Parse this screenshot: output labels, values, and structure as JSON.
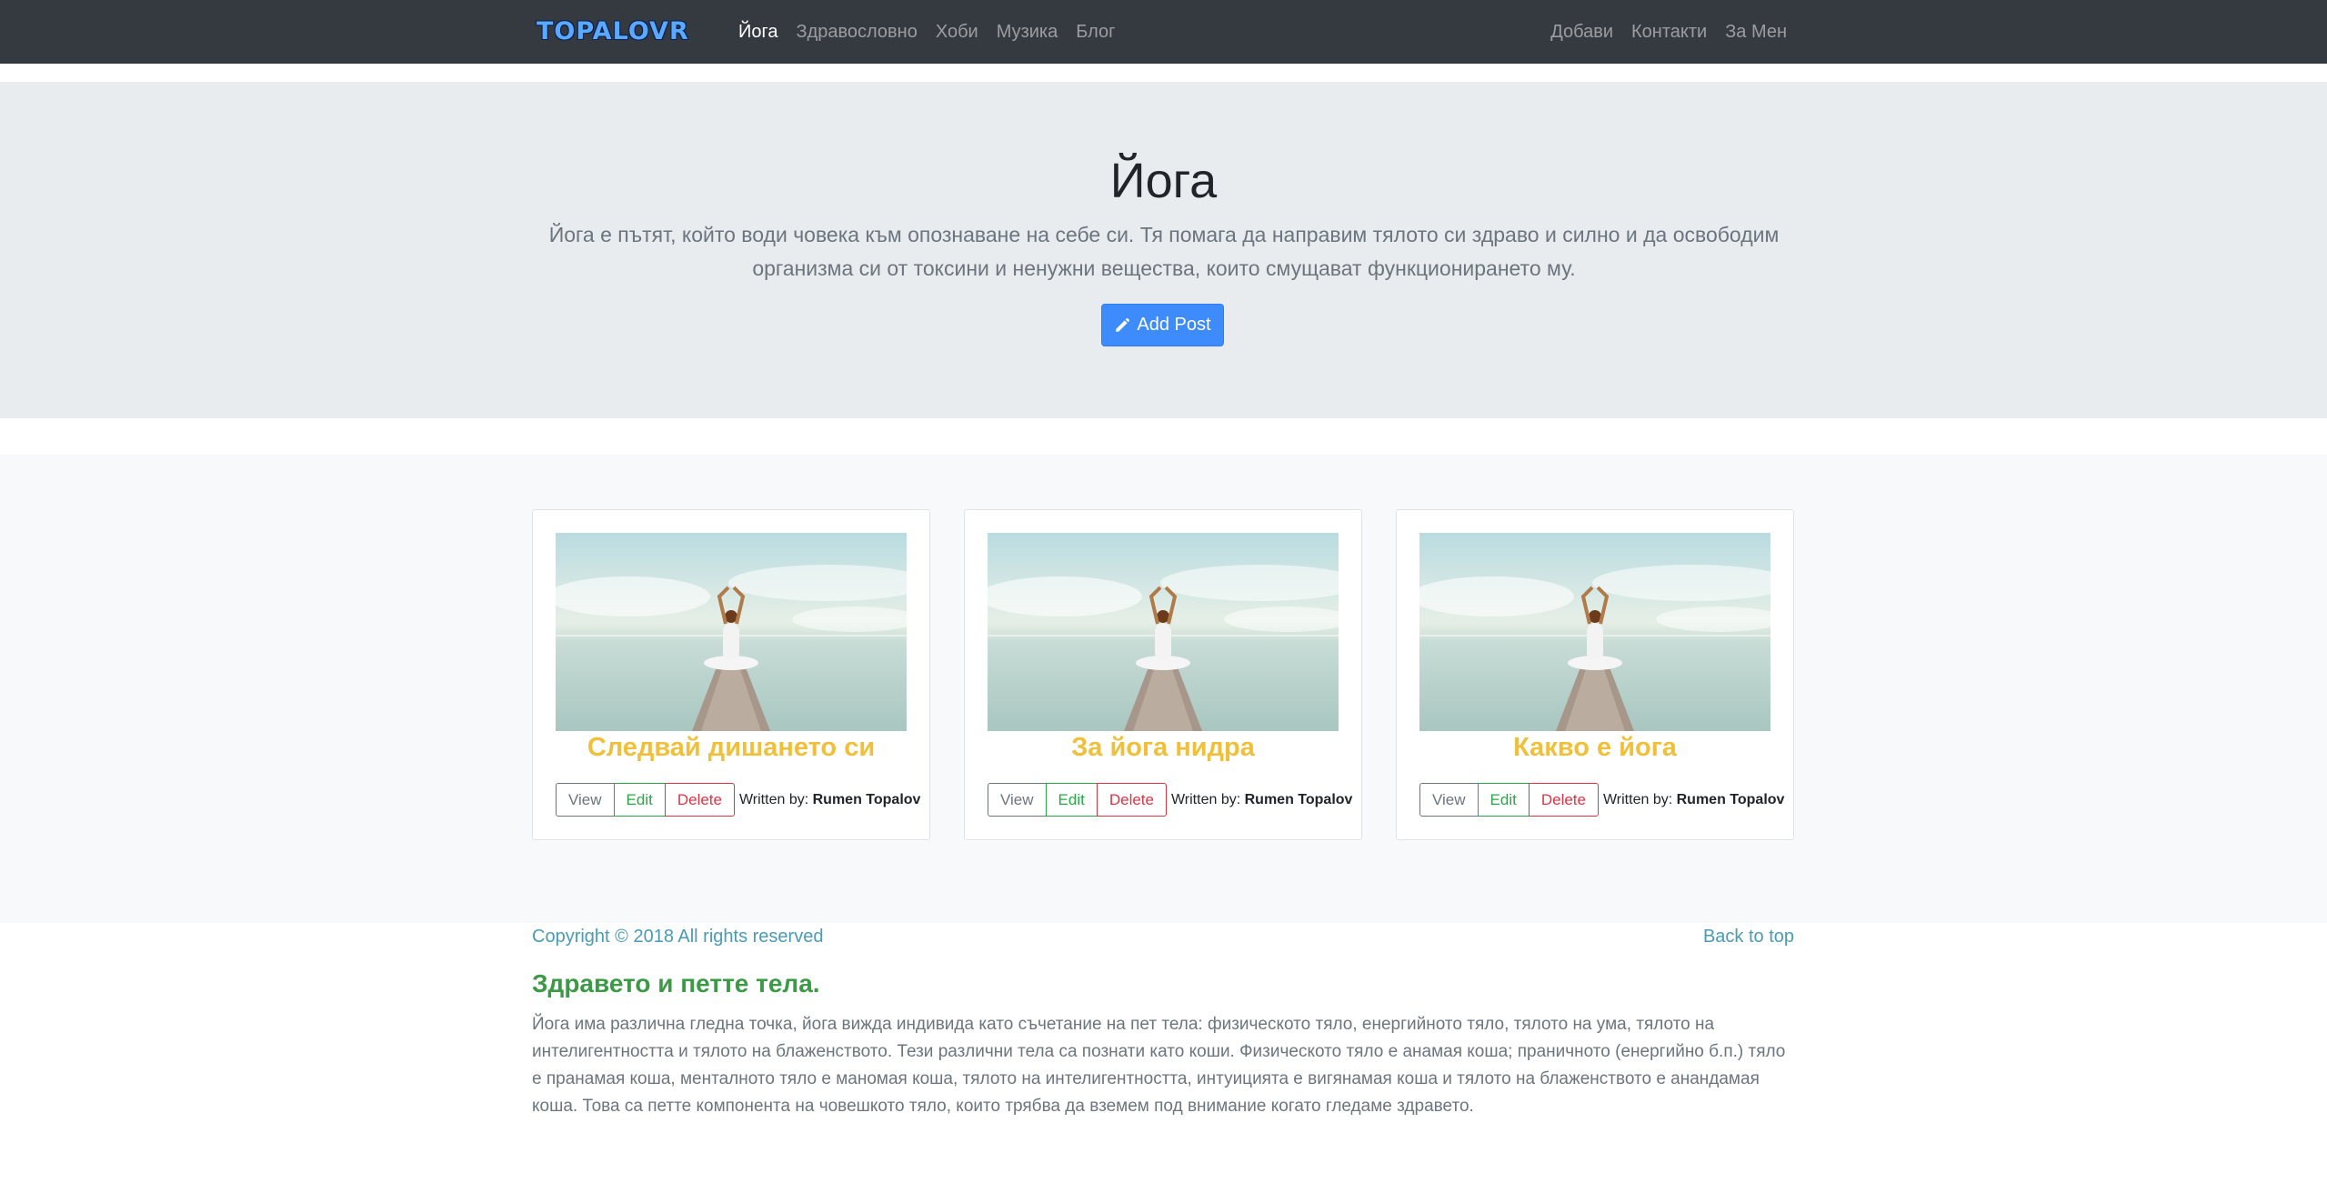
{
  "navbar": {
    "brand": "TOPALOVR",
    "left_links": [
      "Йога",
      "Здравословно",
      "Хоби",
      "Музика",
      "Блог"
    ],
    "right_links": [
      "Добави",
      "Контакти",
      "За Мен"
    ]
  },
  "jumbotron": {
    "title": "Йога",
    "lead": "Йога е пътят, който води човека към опознаване на себе си. Тя помага да направим тялото си здраво и силно и да освободим организма си от токсини и ненужни вещества, които смущават функционирането му.",
    "add_post_label": "Add Post"
  },
  "cards": [
    {
      "title": "Следвай дишането си",
      "view_label": "View",
      "edit_label": "Edit",
      "delete_label": "Delete",
      "written_by": "Written by:",
      "author": "Rumen Topalov"
    },
    {
      "title": "За йога нидра",
      "view_label": "View",
      "edit_label": "Edit",
      "delete_label": "Delete",
      "written_by": "Written by:",
      "author": "Rumen Topalov"
    },
    {
      "title": "Какво е йога",
      "view_label": "View",
      "edit_label": "Edit",
      "delete_label": "Delete",
      "written_by": "Written by:",
      "author": "Rumen Topalov"
    }
  ],
  "footer": {
    "copyright": "Copyright © 2018 All rights reserved",
    "back_to_top": "Back to top",
    "heading": "Здравето и петте тела.",
    "text": "Йога има различна гледна точка, йога вижда индивида като съчетание на пет тела: физическото тяло, енергийното тяло, тялото на ума, тялото на интелигентността и тялото на блаженството. Тези различни тела са познати като коши. Физическото тяло е анамая коша; праничното (енергийно б.п.) тяло е пранамая коша, менталното тяло е маномая коша, тялото на интелигентността, интуицията е вигянамая коша и тялото на блаженството е анандамая коша. Това са петте компонента на човешкото тяло, които трябва да вземем под внимание когато гледаме здравето."
  },
  "colors": {
    "navbar_bg": "#343a40",
    "jumbotron_bg": "#e9ecef",
    "primary": "#3d8bfd",
    "card_title": "#f0c03a",
    "footer_link": "#4a9bb5",
    "footer_heading": "#3c9a47"
  },
  "icons": {
    "add_post": "pencil-icon"
  }
}
